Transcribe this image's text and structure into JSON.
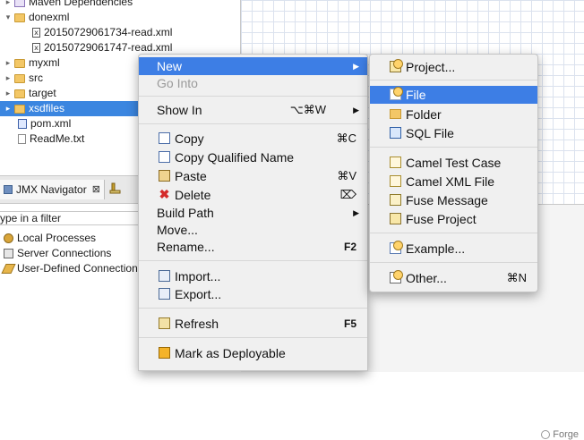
{
  "project_tree": {
    "items": [
      {
        "label": "Maven Dependencies",
        "icon": "library-icon"
      },
      {
        "label": "donexml",
        "icon": "folder-icon"
      },
      {
        "label": "20150729061734-read.xml",
        "icon": "xml-file-icon"
      },
      {
        "label": "20150729061747-read.xml",
        "icon": "xml-file-icon"
      },
      {
        "label": "myxml",
        "icon": "folder-icon"
      },
      {
        "label": "src",
        "icon": "folder-icon"
      },
      {
        "label": "target",
        "icon": "folder-icon"
      },
      {
        "label": "xsdfiles",
        "icon": "folder-icon",
        "selected": true
      },
      {
        "label": "pom.xml",
        "icon": "pom-file-icon"
      },
      {
        "label": "ReadMe.txt",
        "icon": "text-file-icon"
      }
    ]
  },
  "jmx": {
    "tab_label": "JMX Navigator",
    "close_glyph": "⊠",
    "filter_placeholder": "ype in a filter",
    "items": [
      {
        "label": "Local Processes",
        "icon": "gears-icon"
      },
      {
        "label": "Server Connections",
        "icon": "server-icon"
      },
      {
        "label": "User-Defined Connection",
        "icon": "pencil-icon"
      }
    ]
  },
  "editor": {
    "forge_label": "Forge"
  },
  "context_menu": {
    "items": [
      {
        "label": "New",
        "submenu_arrow": "▶",
        "highlighted": true
      },
      {
        "label": "Go Into",
        "disabled": true
      },
      {
        "label": "Show In",
        "shortcut": "⌥⌘W",
        "submenu_arrow": "▶"
      },
      {
        "label": "Copy",
        "shortcut": "⌘C",
        "icon": "copy-icon"
      },
      {
        "label": "Copy Qualified Name",
        "icon": "copy-icon"
      },
      {
        "label": "Paste",
        "shortcut": "⌘V",
        "icon": "paste-icon"
      },
      {
        "label": "Delete",
        "shortcut": "⌦",
        "icon": "delete-icon"
      },
      {
        "label": "Build Path",
        "submenu_arrow": "▶"
      },
      {
        "label": "Move..."
      },
      {
        "label": "Rename...",
        "shortcut": "F2"
      },
      {
        "label": "Import...",
        "icon": "import-icon"
      },
      {
        "label": "Export...",
        "icon": "export-icon"
      },
      {
        "label": "Refresh",
        "shortcut": "F5",
        "icon": "refresh-icon"
      },
      {
        "label": "Mark as Deployable",
        "icon": "deploy-icon"
      }
    ]
  },
  "new_submenu": {
    "items": [
      {
        "label": "Project...",
        "icon": "project-icon"
      },
      {
        "label": "File",
        "icon": "file-icon",
        "highlighted": true
      },
      {
        "label": "Folder",
        "icon": "folder-icon"
      },
      {
        "label": "SQL File",
        "icon": "sql-file-icon"
      },
      {
        "label": "Camel Test Case",
        "icon": "camel-icon"
      },
      {
        "label": "Camel XML File",
        "icon": "camel-icon"
      },
      {
        "label": "Fuse Message",
        "icon": "message-icon"
      },
      {
        "label": "Fuse Project",
        "icon": "fuse-project-icon"
      },
      {
        "label": "Example...",
        "icon": "example-icon"
      },
      {
        "label": "Other...",
        "shortcut": "⌘N",
        "icon": "other-icon"
      }
    ]
  },
  "colors": {
    "menu_highlight": "#3d7ee5",
    "tree_selection": "#3b86e0"
  }
}
